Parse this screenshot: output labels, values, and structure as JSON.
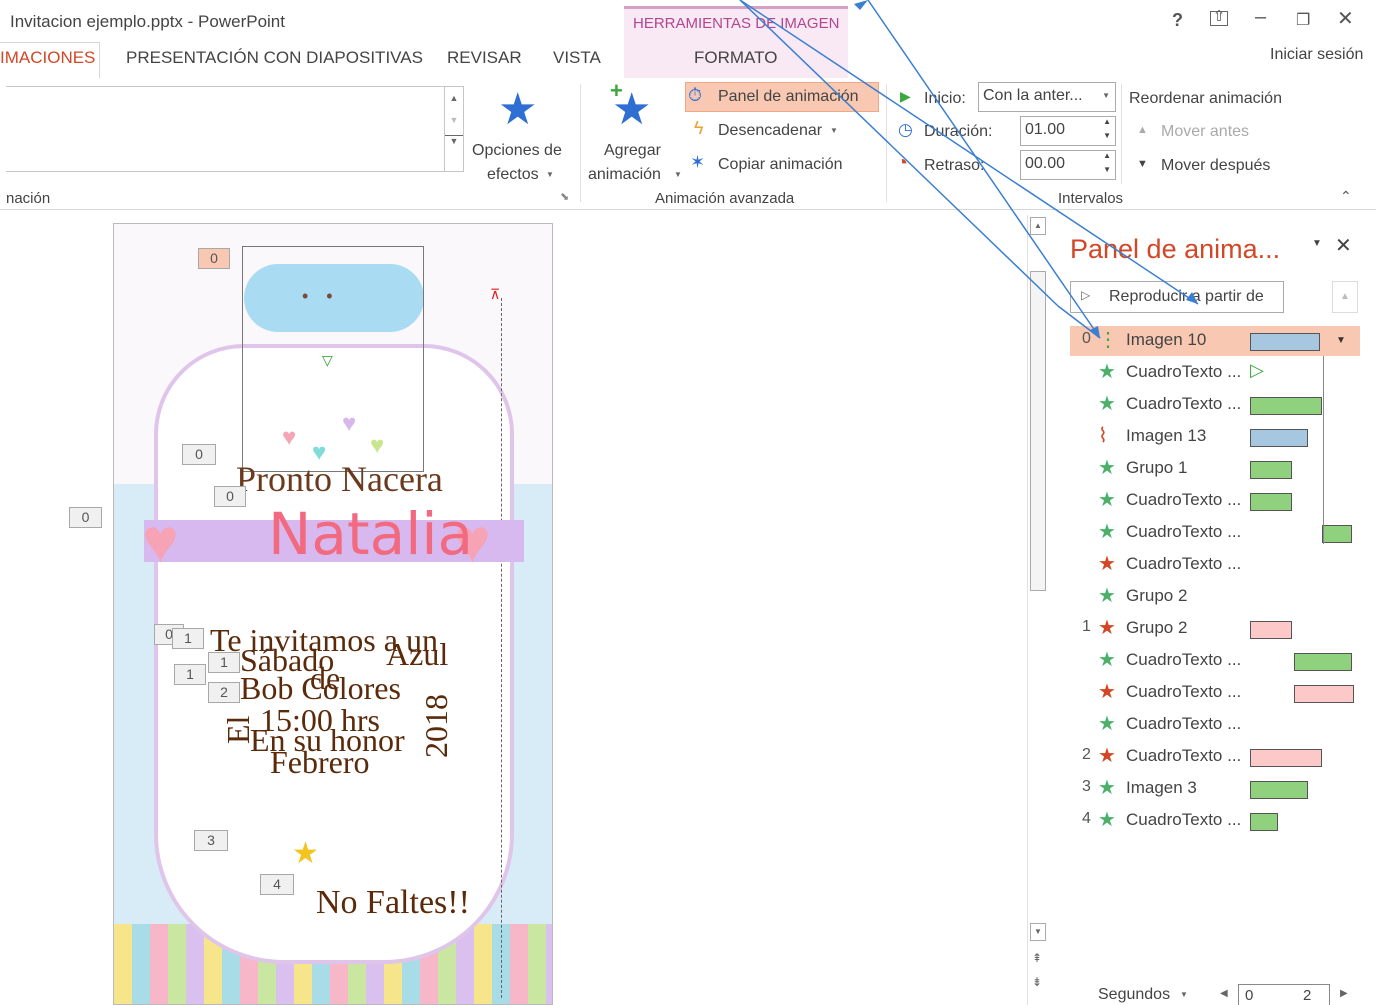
{
  "window": {
    "title": "Invitacion ejemplo.pptx - PowerPoint",
    "signin": "Iniciar sesión",
    "help_glyph": "?"
  },
  "context_tab": {
    "group": "HERRAMIENTAS DE IMAGEN",
    "tab": "FORMATO"
  },
  "tabs": [
    "IMACIONES",
    "PRESENTACIÓN CON DIAPOSITIVAS",
    "REVISAR",
    "VISTA"
  ],
  "ribbon": {
    "group_left_label": "nación",
    "effect_options": {
      "line1": "Opciones de",
      "line2": "efectos"
    },
    "add_animation": {
      "line1": "Agregar",
      "line2": "animación"
    },
    "animation_pane": "Panel de animación",
    "trigger": "Desencadenar",
    "copy_animation": "Copiar animación",
    "advanced_group": "Animación avanzada",
    "start_label": "Inicio:",
    "start_value": "Con la anter...",
    "duration_label": "Duración:",
    "duration_value": "01.00",
    "delay_label": "Retraso:",
    "delay_value": "00.00",
    "timing_group": "Intervalos",
    "reorder": "Reordenar animación",
    "move_earlier": "Mover antes",
    "move_later": "Mover después"
  },
  "slide": {
    "texts": {
      "pronto": "Pronto Nacera",
      "name": "Natalia",
      "faltes": "No Faltes!!",
      "year": "2018",
      "feb": "Febrero",
      "line1": "Te invitamos a un",
      "line2": "Sábado",
      "line3": "Bob Colores",
      "line4": "15:00 hrs",
      "line5": "En su honor",
      "el": "El",
      "azul": "Azul",
      "de": "de"
    },
    "markers": [
      "0",
      "0",
      "0",
      "0",
      "1",
      "1",
      "1",
      "2",
      "3",
      "4",
      "0"
    ]
  },
  "pane": {
    "title": "Panel de anima...",
    "play_button": "Reproducir a partir de",
    "items": [
      {
        "idx": "0",
        "icon": "trigger",
        "name": "Imagen 10",
        "color": "b"
      },
      {
        "idx": "",
        "icon": "green-star",
        "name": "CuadroTexto ...",
        "color": "g"
      },
      {
        "idx": "",
        "icon": "green-star",
        "name": "CuadroTexto ...",
        "color": "g"
      },
      {
        "idx": "",
        "icon": "path",
        "name": "Imagen 13",
        "color": "b"
      },
      {
        "idx": "",
        "icon": "green-star",
        "name": "Grupo 1",
        "color": "g"
      },
      {
        "idx": "",
        "icon": "green-star",
        "name": "CuadroTexto ...",
        "color": "g"
      },
      {
        "idx": "",
        "icon": "green-star",
        "name": "CuadroTexto ...",
        "color": "g"
      },
      {
        "idx": "",
        "icon": "red-star",
        "name": "CuadroTexto ...",
        "color": ""
      },
      {
        "idx": "",
        "icon": "green-star",
        "name": "Grupo 2",
        "color": ""
      },
      {
        "idx": "1",
        "icon": "red-star",
        "name": "Grupo 2",
        "color": "p"
      },
      {
        "idx": "",
        "icon": "green-star",
        "name": "CuadroTexto ...",
        "color": "g"
      },
      {
        "idx": "",
        "icon": "red-star",
        "name": "CuadroTexto ...",
        "color": "p"
      },
      {
        "idx": "",
        "icon": "green-star",
        "name": "CuadroTexto ...",
        "color": ""
      },
      {
        "idx": "2",
        "icon": "red-star",
        "name": "CuadroTexto ...",
        "color": "p"
      },
      {
        "idx": "3",
        "icon": "green-star",
        "name": "Imagen 3",
        "color": "g"
      },
      {
        "idx": "4",
        "icon": "green-star",
        "name": "CuadroTexto ...",
        "color": "g"
      }
    ],
    "seconds_label": "Segundos",
    "ruler": [
      "0",
      "2"
    ]
  },
  "colors": {
    "accent": "#d24726",
    "selected_row": "#f9c8b2",
    "ctx_band": "#f8e9f4"
  }
}
